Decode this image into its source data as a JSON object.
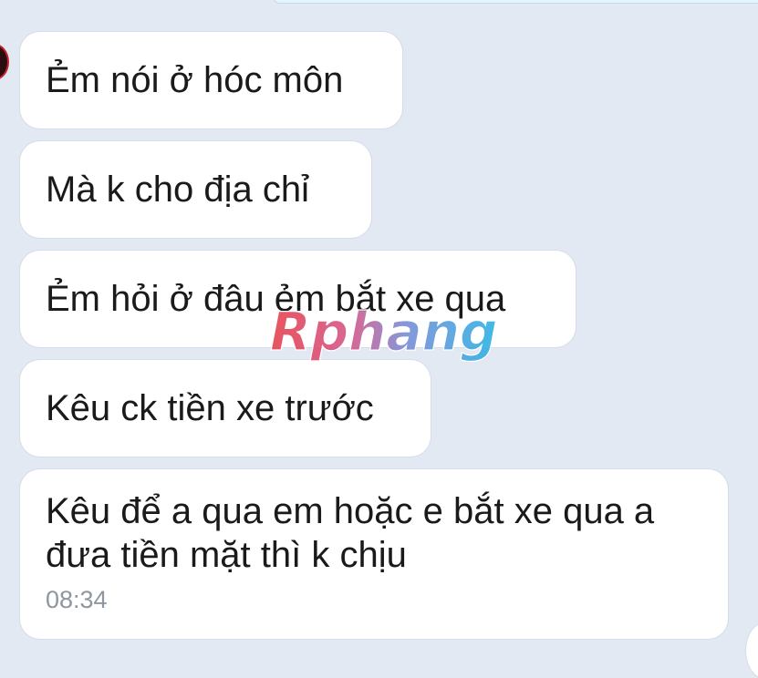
{
  "messages": [
    {
      "text": "Ẻm nói ở hóc môn"
    },
    {
      "text": "Mà k cho địa chỉ"
    },
    {
      "text": "Ẻm hỏi ở đâu ẻm bắt xe qua"
    },
    {
      "text": "Kêu ck tiền xe trước"
    },
    {
      "text": "Kêu để a qua em hoặc e bắt xe qua a đưa tiền mặt thì k chịu",
      "time": "08:34"
    }
  ],
  "watermark": {
    "text": "Rphang"
  },
  "colors": {
    "background": "#e2e9f2",
    "bubble": "#ffffff",
    "text": "#1a1a1a",
    "timestamp": "#8e96a0",
    "watermark_red": "#e64550",
    "watermark_blue": "#2fb4e4"
  },
  "icons": {
    "avatar": "avatar-image",
    "corner": "scroll-down-button"
  }
}
